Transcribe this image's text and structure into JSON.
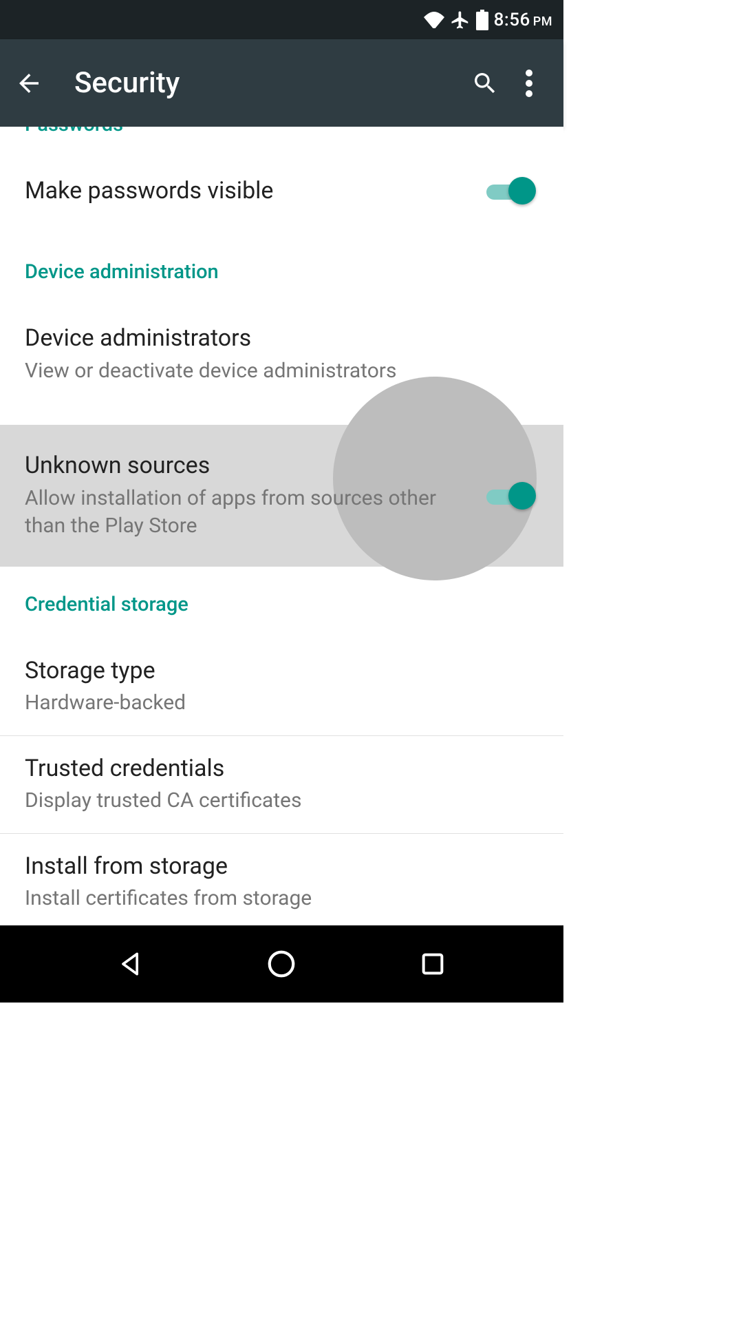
{
  "colors": {
    "accent": "#009688",
    "appbar": "#2f3c42",
    "statusbar": "#1c2326"
  },
  "status": {
    "time": "8:56",
    "ampm": "PM"
  },
  "appbar": {
    "title": "Security"
  },
  "sections": {
    "passwords": {
      "header": "Passwords",
      "make_visible": {
        "title": "Make passwords visible",
        "on": true
      }
    },
    "device_admin": {
      "header": "Device administration",
      "administrators": {
        "title": "Device administrators",
        "summary": "View or deactivate device administrators"
      },
      "unknown_sources": {
        "title": "Unknown sources",
        "summary": "Allow installation of apps from sources other than the Play Store",
        "on": true
      }
    },
    "credential_storage": {
      "header": "Credential storage",
      "storage_type": {
        "title": "Storage type",
        "summary": "Hardware-backed"
      },
      "trusted": {
        "title": "Trusted credentials",
        "summary": "Display trusted CA certificates"
      },
      "install": {
        "title": "Install from storage",
        "summary": "Install certificates from storage"
      }
    }
  }
}
